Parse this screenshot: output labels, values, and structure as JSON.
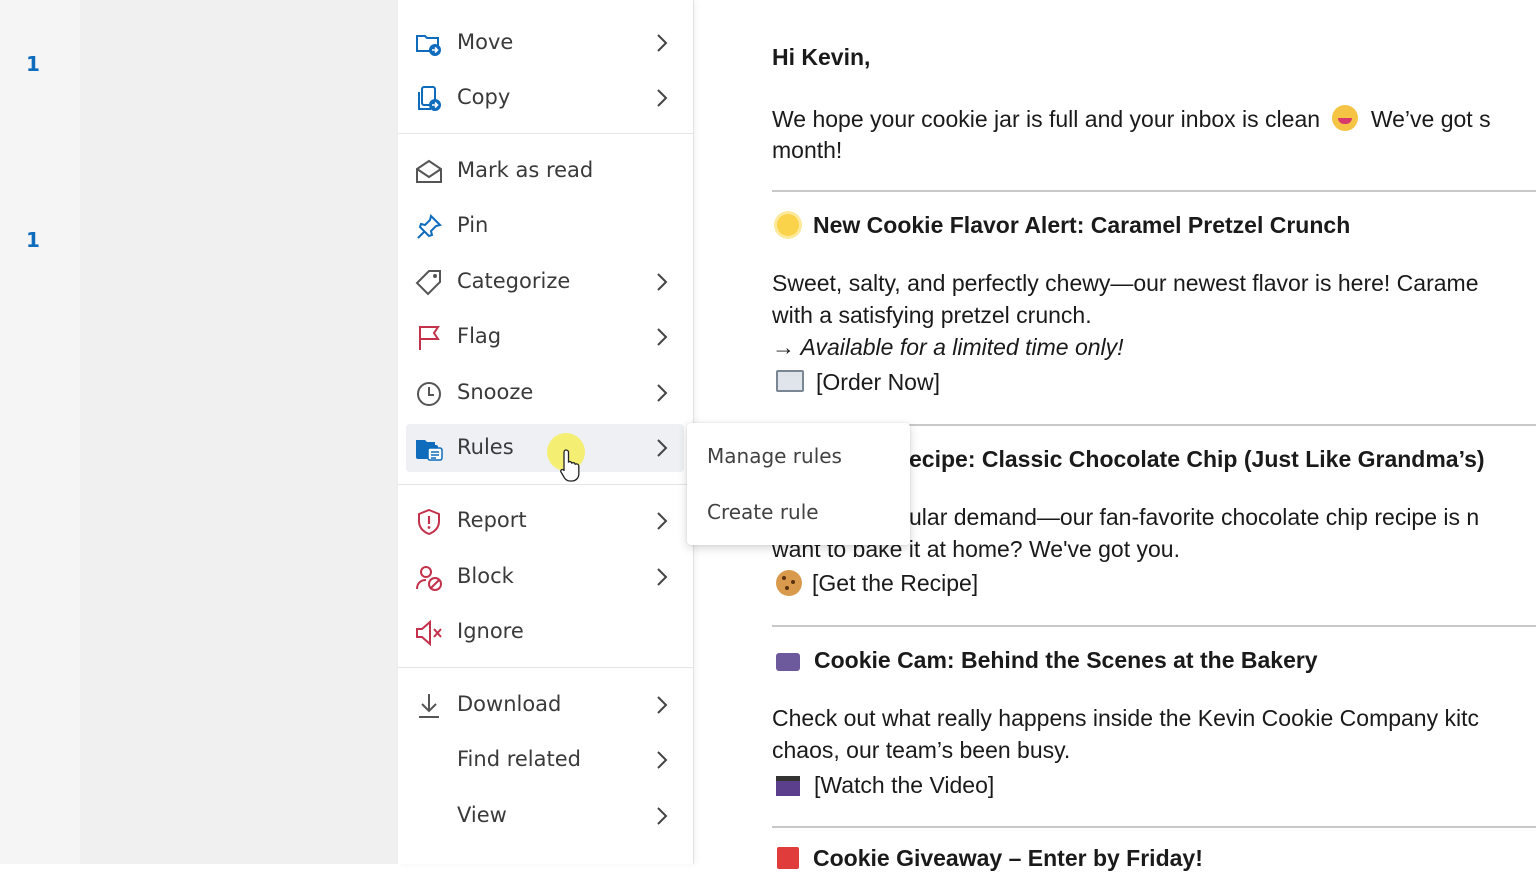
{
  "left_list": {
    "counts": [
      "1",
      "1"
    ]
  },
  "context_menu": {
    "items": [
      {
        "label": "Move",
        "icon": "folder-move-icon"
      },
      {
        "label": "Copy",
        "icon": "copy-icon"
      },
      {
        "label": "Mark as read",
        "icon": "envelope-open-icon"
      },
      {
        "label": "Pin",
        "icon": "pin-icon"
      },
      {
        "label": "Categorize",
        "icon": "tag-icon"
      },
      {
        "label": "Flag",
        "icon": "flag-icon"
      },
      {
        "label": "Snooze",
        "icon": "clock-icon"
      },
      {
        "label": "Rules",
        "icon": "rules-icon"
      },
      {
        "label": "Report",
        "icon": "shield-icon"
      },
      {
        "label": "Block",
        "icon": "block-person-icon"
      },
      {
        "label": "Ignore",
        "icon": "mute-icon"
      },
      {
        "label": "Download",
        "icon": "download-icon"
      },
      {
        "label": "Find related",
        "icon": ""
      },
      {
        "label": "View",
        "icon": ""
      }
    ]
  },
  "rules_submenu": {
    "manage": "Manage rules",
    "create": "Create rule"
  },
  "email": {
    "greeting": "Hi Kevin,",
    "intro_1": "We hope your cookie jar is full and your inbox is clean",
    "intro_1b": "We’ve got s",
    "intro_2": "month!",
    "s1_title": "New Cookie Flavor Alert: Caramel Pretzel Crunch",
    "s1_l1": "Sweet, salty, and perfectly chewy—our newest flavor is here! Carame",
    "s1_l2": "with a satisfying pretzel crunch.",
    "s1_l3": "→ Available for a limited time only!",
    "s1_link": "[Order Now]",
    "s2_title": "ecipe: Classic Chocolate Chip (Just Like Grandma’s)",
    "s2_l1": "ular demand—our fan-favorite chocolate chip recipe is n",
    "s2_l2": "want to bake it at home? We've got you.",
    "s2_link": "[Get the Recipe]",
    "s3_title": "Cookie Cam: Behind the Scenes at the Bakery",
    "s3_l1": "Check out what really happens inside the Kevin Cookie Company kitc",
    "s3_l2": "chaos, our team’s been busy.",
    "s3_link": "[Watch the Video]",
    "s4_title": "Cookie Giveaway – Enter by Friday!"
  },
  "colors": {
    "accent": "#0f6cbd",
    "flag": "#c4314b",
    "report": "#c4314b"
  }
}
